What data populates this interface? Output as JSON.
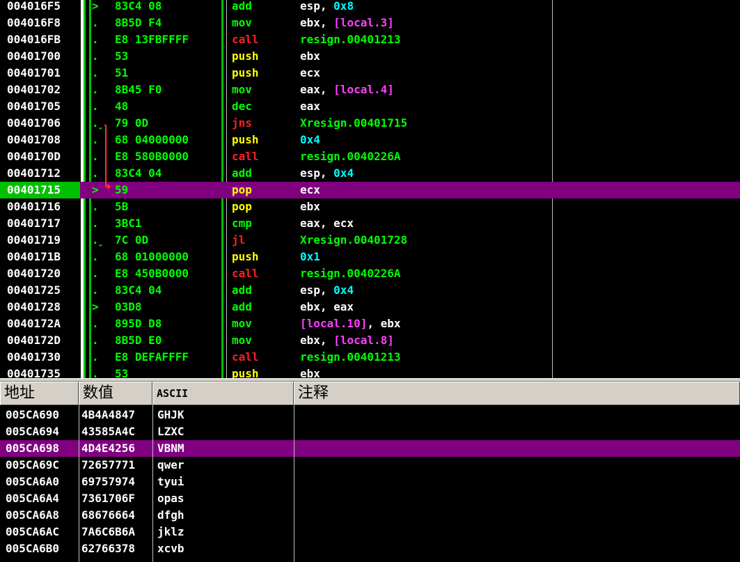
{
  "disasm": {
    "rows": [
      {
        "addr": "004016F5",
        "mark": ">",
        "hex": "83C4 08",
        "mnem": "add",
        "mclass": "m-green",
        "ops": [
          {
            "t": "esp, ",
            "c": "o-white"
          },
          {
            "t": "0x8",
            "c": "o-cyan"
          }
        ]
      },
      {
        "addr": "004016F8",
        "mark": ".",
        "hex": "8B5D F4",
        "mnem": "mov",
        "mclass": "m-green",
        "ops": [
          {
            "t": "ebx, ",
            "c": "o-white"
          },
          {
            "t": "[local.3]",
            "c": "o-magenta"
          }
        ]
      },
      {
        "addr": "004016FB",
        "mark": ".",
        "hex": "E8 13FBFFFF",
        "mnem": "call",
        "mclass": "m-red",
        "ops": [
          {
            "t": "resign.00401213",
            "c": "o-green"
          }
        ]
      },
      {
        "addr": "00401700",
        "mark": ".",
        "hex": "53",
        "mnem": "push",
        "mclass": "m-yellow",
        "ops": [
          {
            "t": "ebx",
            "c": "o-white"
          }
        ]
      },
      {
        "addr": "00401701",
        "mark": ".",
        "hex": "51",
        "mnem": "push",
        "mclass": "m-yellow",
        "ops": [
          {
            "t": "ecx",
            "c": "o-white"
          }
        ]
      },
      {
        "addr": "00401702",
        "mark": ".",
        "hex": "8B45 F0",
        "mnem": "mov",
        "mclass": "m-green",
        "ops": [
          {
            "t": "eax, ",
            "c": "o-white"
          },
          {
            "t": "[local.4]",
            "c": "o-magenta"
          }
        ]
      },
      {
        "addr": "00401705",
        "mark": ".",
        "hex": "48",
        "mnem": "dec",
        "mclass": "m-green",
        "ops": [
          {
            "t": "eax",
            "c": "o-white"
          }
        ]
      },
      {
        "addr": "00401706",
        "mark": ".ˬ",
        "hex": "79 0D",
        "mnem": "jns",
        "mclass": "m-red",
        "ops": [
          {
            "t": "Xresign.00401715",
            "c": "o-green"
          }
        ]
      },
      {
        "addr": "00401708",
        "mark": ".",
        "hex": "68 04000000",
        "mnem": "push",
        "mclass": "m-yellow",
        "ops": [
          {
            "t": "0x4",
            "c": "o-cyan"
          }
        ]
      },
      {
        "addr": "0040170D",
        "mark": ".",
        "hex": "E8 580B0000",
        "mnem": "call",
        "mclass": "m-red",
        "ops": [
          {
            "t": "resign.0040226A",
            "c": "o-green"
          }
        ]
      },
      {
        "addr": "00401712",
        "mark": ".",
        "hex": "83C4 04",
        "mnem": "add",
        "mclass": "m-green",
        "ops": [
          {
            "t": "esp, ",
            "c": "o-white"
          },
          {
            "t": "0x4",
            "c": "o-cyan"
          }
        ]
      },
      {
        "addr": "00401715",
        "mark": ">",
        "hex": "59",
        "mnem": "pop",
        "mclass": "m-yellow",
        "ops": [
          {
            "t": "ecx",
            "c": "o-white"
          }
        ],
        "hl": true
      },
      {
        "addr": "00401716",
        "mark": ".",
        "hex": "5B",
        "mnem": "pop",
        "mclass": "m-yellow",
        "ops": [
          {
            "t": "ebx",
            "c": "o-white"
          }
        ]
      },
      {
        "addr": "00401717",
        "mark": ".",
        "hex": "3BC1",
        "mnem": "cmp",
        "mclass": "m-green",
        "ops": [
          {
            "t": "eax, ecx",
            "c": "o-white"
          }
        ]
      },
      {
        "addr": "00401719",
        "mark": ".ˬ",
        "hex": "7C 0D",
        "mnem": "jl",
        "mclass": "m-red",
        "ops": [
          {
            "t": "Xresign.00401728",
            "c": "o-green"
          }
        ]
      },
      {
        "addr": "0040171B",
        "mark": ".",
        "hex": "68 01000000",
        "mnem": "push",
        "mclass": "m-yellow",
        "ops": [
          {
            "t": "0x1",
            "c": "o-cyan"
          }
        ]
      },
      {
        "addr": "00401720",
        "mark": ".",
        "hex": "E8 450B0000",
        "mnem": "call",
        "mclass": "m-red",
        "ops": [
          {
            "t": "resign.0040226A",
            "c": "o-green"
          }
        ]
      },
      {
        "addr": "00401725",
        "mark": ".",
        "hex": "83C4 04",
        "mnem": "add",
        "mclass": "m-green",
        "ops": [
          {
            "t": "esp, ",
            "c": "o-white"
          },
          {
            "t": "0x4",
            "c": "o-cyan"
          }
        ]
      },
      {
        "addr": "00401728",
        "mark": ">",
        "hex": "03D8",
        "mnem": "add",
        "mclass": "m-green",
        "ops": [
          {
            "t": "ebx, eax",
            "c": "o-white"
          }
        ]
      },
      {
        "addr": "0040172A",
        "mark": ".",
        "hex": "895D D8",
        "mnem": "mov",
        "mclass": "m-green",
        "ops": [
          {
            "t": "[local.10]",
            "c": "o-magenta"
          },
          {
            "t": ", ebx",
            "c": "o-white"
          }
        ]
      },
      {
        "addr": "0040172D",
        "mark": ".",
        "hex": "8B5D E0",
        "mnem": "mov",
        "mclass": "m-green",
        "ops": [
          {
            "t": "ebx, ",
            "c": "o-white"
          },
          {
            "t": "[local.8]",
            "c": "o-magenta"
          }
        ]
      },
      {
        "addr": "00401730",
        "mark": ".",
        "hex": "E8 DEFAFFFF",
        "mnem": "call",
        "mclass": "m-red",
        "ops": [
          {
            "t": "resign.00401213",
            "c": "o-green"
          }
        ]
      },
      {
        "addr": "00401735",
        "mark": ".",
        "hex": "53",
        "mnem": "push",
        "mclass": "m-yellow",
        "ops": [
          {
            "t": "ebx",
            "c": "o-white"
          }
        ]
      }
    ]
  },
  "dump": {
    "headers": {
      "address": "地址",
      "value": "数值",
      "ascii": "ASCII",
      "comment": "注释"
    },
    "rows": [
      {
        "addr": "005CA690",
        "val": "4B4A4847",
        "asc": "GHJK"
      },
      {
        "addr": "005CA694",
        "val": "43585A4C",
        "asc": "LZXC"
      },
      {
        "addr": "005CA698",
        "val": "4D4E4256",
        "asc": "VBNM",
        "hl": true
      },
      {
        "addr": "005CA69C",
        "val": "72657771",
        "asc": "qwer"
      },
      {
        "addr": "005CA6A0",
        "val": "69757974",
        "asc": "tyui"
      },
      {
        "addr": "005CA6A4",
        "val": "7361706F",
        "asc": "opas"
      },
      {
        "addr": "005CA6A8",
        "val": "68676664",
        "asc": "dfgh"
      },
      {
        "addr": "005CA6AC",
        "val": "7A6C6B6A",
        "asc": "jklz"
      },
      {
        "addr": "005CA6B0",
        "val": "62766378",
        "asc": "xcvb"
      }
    ]
  }
}
